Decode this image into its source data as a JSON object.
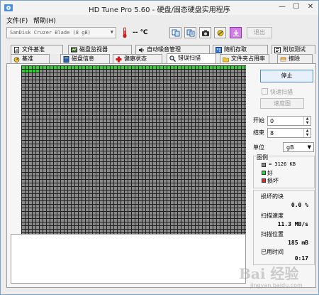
{
  "window": {
    "title": "HD Tune Pro 5.60 - 硬盘/固态硬盘实用程序",
    "minimize": "—",
    "maximize": "☐",
    "close": "✕"
  },
  "menu": {
    "file": "文件(F)",
    "help": "帮助(H)"
  },
  "toolbar": {
    "drive": "SanDisk Cruzer Blade (8 gB)",
    "temperature": "-- ℃",
    "exit_label": "退出"
  },
  "tabs_top": [
    {
      "label": "文件基准",
      "icon": "file-benchmark-icon"
    },
    {
      "label": "磁盘监视器",
      "icon": "disk-monitor-icon"
    },
    {
      "label": "自动噪音管理",
      "icon": "noise-icon"
    },
    {
      "label": "随机存取",
      "icon": "random-access-icon"
    },
    {
      "label": "附加测试",
      "icon": "extra-tests-icon"
    }
  ],
  "tabs_bottom": [
    {
      "label": "基准",
      "icon": "benchmark-icon"
    },
    {
      "label": "磁盘信息",
      "icon": "disk-info-icon"
    },
    {
      "label": "健康状态",
      "icon": "health-icon"
    },
    {
      "label": "错误扫描",
      "icon": "error-scan-icon"
    },
    {
      "label": "文件夹占用率",
      "icon": "folder-usage-icon"
    },
    {
      "label": "擦除",
      "icon": "erase-icon"
    }
  ],
  "active_tab": "错误扫描",
  "scan": {
    "stop_label": "停止",
    "quick_scan_label": "快速扫描",
    "speed_map_label": "速度图",
    "start_label": "开始",
    "start_value": "0",
    "end_label": "结束",
    "end_value": "8",
    "unit_label": "单位",
    "unit_value": "gB",
    "legend_title": "图例",
    "legend_block": "= 3126 KB",
    "legend_good": "好",
    "legend_bad": "损坏",
    "damaged_label": "损坏的块",
    "damaged_value": "0.0 %",
    "speed_label": "扫描速度",
    "speed_value": "11.3 MB/s",
    "position_label": "扫描位置",
    "position_value": "185 mB",
    "elapsed_label": "已用时间",
    "elapsed_value": "0:17",
    "progress_fraction": 0.023
  },
  "colors": {
    "good": "#2bd42b",
    "bad": "#d42b2b",
    "untested": "#8a8a8a"
  },
  "watermark": {
    "logo": "Bai 经验",
    "sub": "jingyan.baidu.com"
  }
}
